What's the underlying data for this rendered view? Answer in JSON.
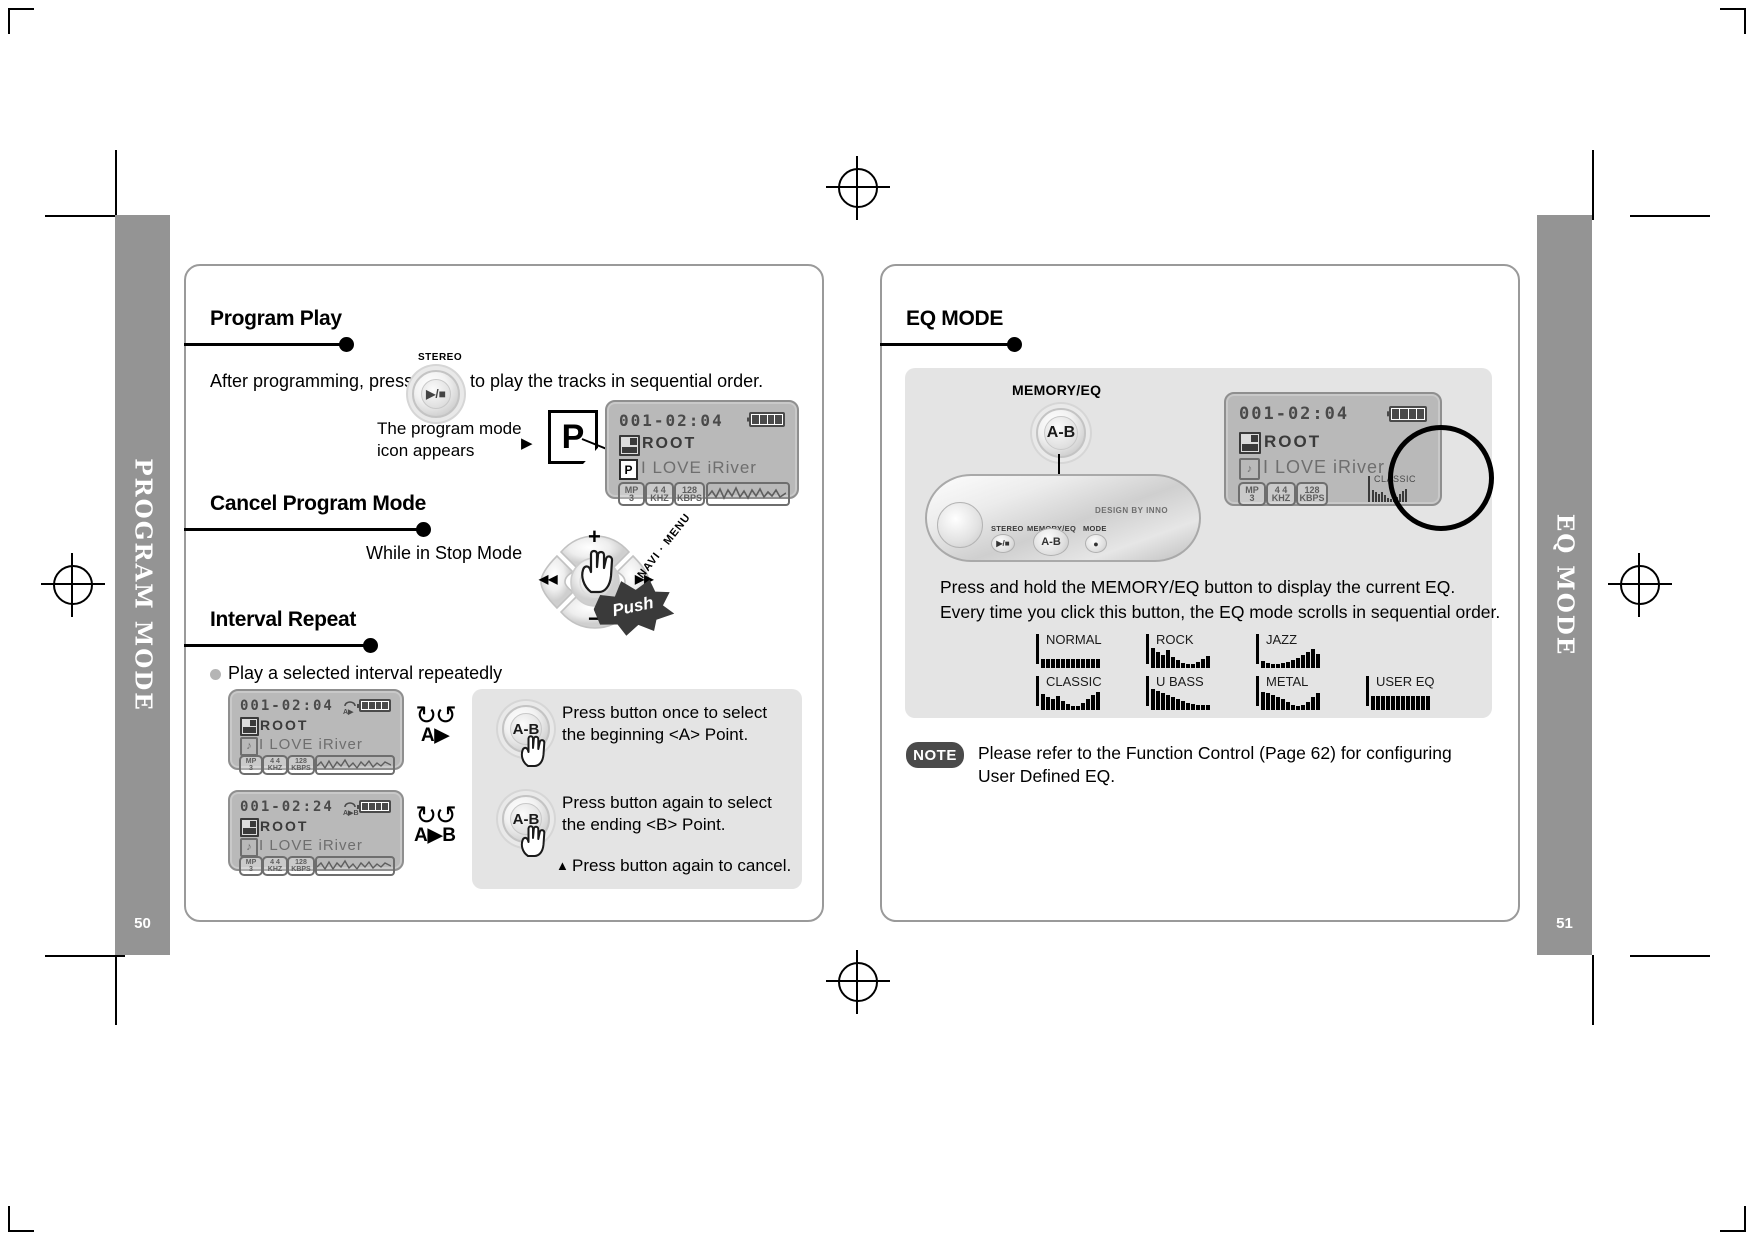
{
  "left_page": {
    "tab_label": "PROGRAM MODE",
    "page_number": "50",
    "sections": [
      {
        "title": "Program Play"
      },
      {
        "title": "Cancel Program Mode"
      },
      {
        "title": "Interval Repeat"
      }
    ],
    "program_play": {
      "text_before": "After programming, press",
      "text_after": "to play the tracks in sequential order.",
      "stereo_label": "STEREO",
      "play_stop_glyph": "▶/■",
      "callout_line1": "The program mode",
      "callout_line2": "icon appears",
      "callout_arrow": "▶",
      "program_icon_letter": "P",
      "lcd": {
        "time": "001-02:04",
        "folder": "ROOT",
        "song": "I LOVE  iRiver",
        "program_badge": "P",
        "codec": [
          "MP 3",
          "4 4 KHZ",
          "128 KBPS"
        ],
        "codec_lines": [
          [
            "MP",
            "3"
          ],
          [
            "4 4",
            "KHZ"
          ],
          [
            "128",
            "KBPS"
          ]
        ]
      }
    },
    "cancel_program": {
      "text": "While in Stop Mode",
      "navpad": {
        "plus": "+",
        "minus": "−",
        "rew": "◀◀",
        "ff": "▶▶",
        "navi_label": "NAVI · MENU",
        "push_label": "Push"
      }
    },
    "interval_repeat": {
      "bullet_text": "Play a selected interval repeatedly",
      "lcd_a": {
        "time": "001-02:04",
        "folder": "ROOT",
        "song": "I LOVE  iRiver",
        "repeat_mark": "A▶",
        "codec_lines": [
          [
            "MP",
            "3"
          ],
          [
            "4 4",
            "KHZ"
          ],
          [
            "128",
            "KBPS"
          ]
        ]
      },
      "lcd_b": {
        "time": "001-02:24",
        "folder": "ROOT",
        "song": "I LOVE  iRiver",
        "repeat_mark": "A▶B",
        "codec_lines": [
          [
            "MP",
            "3"
          ],
          [
            "4 4",
            "KHZ"
          ],
          [
            "128",
            "KBPS"
          ]
        ]
      },
      "glyph_a": {
        "arcs": "↻↺",
        "label": "A▶"
      },
      "glyph_b": {
        "arcs": "↻↺",
        "label": "A▶B"
      },
      "steps": [
        {
          "button": "A-B",
          "line1": "Press button once to select",
          "line2": "the beginning <A> Point."
        },
        {
          "button": "A-B",
          "line1": "Press button again to select",
          "line2": "the ending <B> Point."
        }
      ],
      "cancel_note": "Press button again to cancel.",
      "cancel_marker": "▲"
    }
  },
  "right_page": {
    "tab_label": "EQ MODE",
    "page_number": "51",
    "section_title": "EQ MODE",
    "memory_eq_label": "MEMORY/EQ",
    "ab_button_label": "A-B",
    "instructions": [
      "Press and hold the MEMORY/EQ button to display the current EQ.",
      "Every time you click this button, the EQ mode scrolls in sequential order."
    ],
    "player": {
      "design_text": "DESIGN BY INNO",
      "captions": [
        "STEREO",
        "MEMORY/EQ",
        "MODE"
      ],
      "buttons": [
        "▶/■",
        "A-B",
        "●"
      ]
    },
    "lcd": {
      "time": "001-02:04",
      "folder": "ROOT",
      "song": "I LOVE  iRiver",
      "codec_lines": [
        [
          "MP",
          "3"
        ],
        [
          "4 4",
          "KHZ"
        ],
        [
          "128",
          "KBPS"
        ]
      ],
      "eq_caption": "CLASSIC"
    },
    "eq_presets": [
      {
        "name": "NORMAL",
        "bars": [
          9,
          9,
          9,
          9,
          9,
          9,
          9,
          9,
          9,
          9,
          9,
          9
        ]
      },
      {
        "name": "ROCK",
        "bars": [
          20,
          16,
          13,
          18,
          11,
          8,
          5,
          4,
          4,
          6,
          9,
          12
        ]
      },
      {
        "name": "JAZZ",
        "bars": [
          7,
          5,
          4,
          4,
          5,
          6,
          8,
          10,
          13,
          16,
          19,
          14
        ]
      },
      {
        "name": "CLASSIC",
        "bars": [
          16,
          13,
          11,
          14,
          9,
          6,
          4,
          4,
          7,
          11,
          15,
          18
        ]
      },
      {
        "name": "U BASS",
        "bars": [
          21,
          19,
          17,
          15,
          13,
          11,
          9,
          7,
          6,
          5,
          5,
          5
        ]
      },
      {
        "name": "METAL",
        "bars": [
          18,
          17,
          15,
          13,
          11,
          8,
          5,
          4,
          5,
          8,
          13,
          17
        ]
      },
      {
        "name": "USER EQ",
        "bars": [
          14,
          14,
          14,
          14,
          14,
          14,
          14,
          14,
          14,
          14,
          14,
          14
        ]
      }
    ],
    "note": {
      "pill": "NOTE",
      "line1": "Please refer to the Function Control (Page 62) for configuring",
      "line2": "User Defined EQ."
    }
  }
}
